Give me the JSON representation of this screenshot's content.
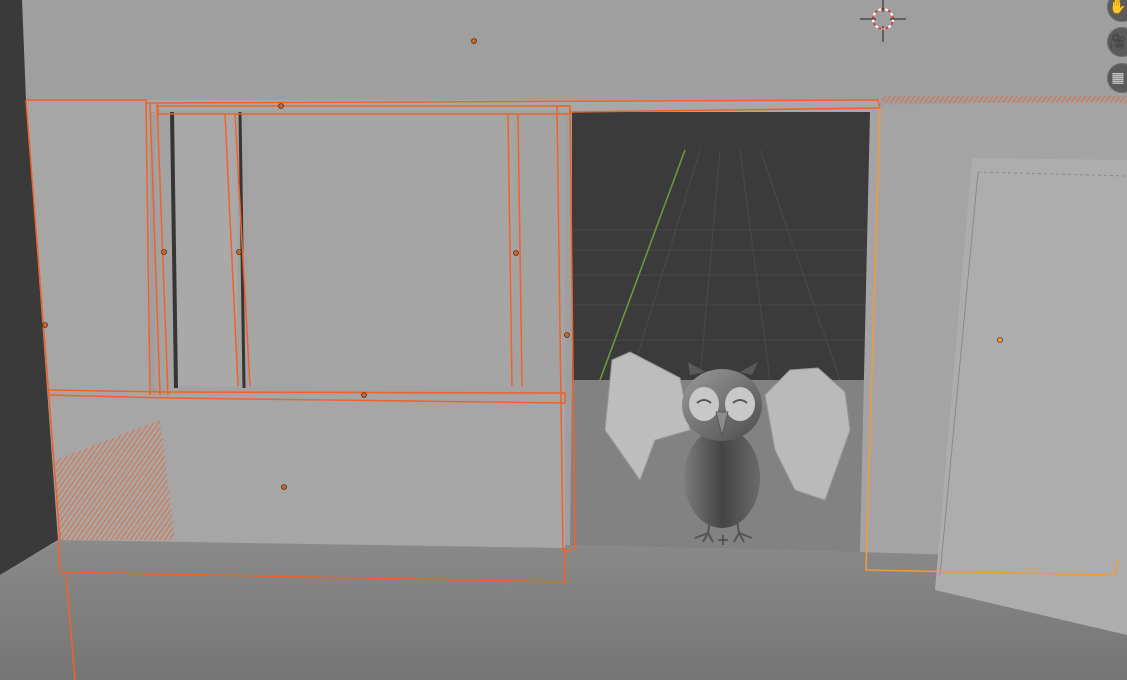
{
  "app": "3D Viewport",
  "gizmos": {
    "hand_glyph": "✋",
    "camera_glyph": "🎥",
    "grid_glyph": "▦",
    "icons": [
      "hand-pan-icon",
      "camera-view-icon",
      "grid-ortho-icon"
    ]
  },
  "colors": {
    "selection_outline": "#f0622a",
    "active_outline": "#f29a35",
    "wall": "#a6a6a6",
    "floor": "#7d7d7d",
    "void": "#3b3b3b",
    "y_axis": "#6f9a3a"
  },
  "objects": [
    "wall-left-with-window",
    "window-frame",
    "doorway",
    "wall-right",
    "door-panel",
    "owl-model",
    "floor-plane"
  ]
}
